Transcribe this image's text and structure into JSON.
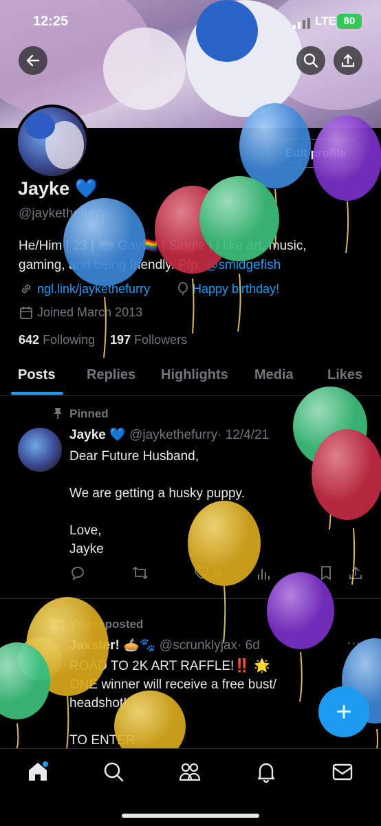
{
  "status_bar": {
    "time": "12:25",
    "network": "LTE",
    "battery": "80"
  },
  "profile": {
    "display_name": "Jayke",
    "verified_emoji": "💙",
    "handle": "@jaykethefurry",
    "edit_button": "Edit profile",
    "bio_line1": "He/Him | 23 | 🏳️‍🌈 Gay🏳️‍🌈 | Single | I like art, music,",
    "bio_line2_prefix": "gaming, and being friendly. Pfp: ",
    "bio_mention": "@smidgefish",
    "link": "ngl.link/jaykethefurry",
    "birthday": "Happy birthday!",
    "joined": "Joined March 2013",
    "following_count": "642",
    "following_label": "Following",
    "followers_count": "197",
    "followers_label": "Followers"
  },
  "tabs": [
    "Posts",
    "Replies",
    "Highlights",
    "Media",
    "Likes"
  ],
  "posts": [
    {
      "context": "Pinned",
      "name": "Jayke",
      "emoji": "💙",
      "handle": "@jaykethefurry",
      "date": "· 12/4/21",
      "lines": [
        "Dear Future Husband,",
        "",
        "We are getting a husky puppy.",
        "",
        "Love,",
        "Jayke"
      ],
      "likes": "11"
    },
    {
      "context": "You reposted",
      "name": "Jaxster!",
      "emoji": "🥧🐾",
      "handle": "@scrunklyjax",
      "date": "· 6d",
      "more": "···",
      "lines": [
        "ROAD TO 2K ART RAFFLE!‼️ 🌟",
        "ONE winner will receive a free bust/",
        "headshot!",
        "",
        "TO ENTER:"
      ]
    }
  ],
  "fab": "+",
  "colors": {
    "accent": "#1d9bf0",
    "background": "#000000",
    "muted": "#71767b"
  }
}
